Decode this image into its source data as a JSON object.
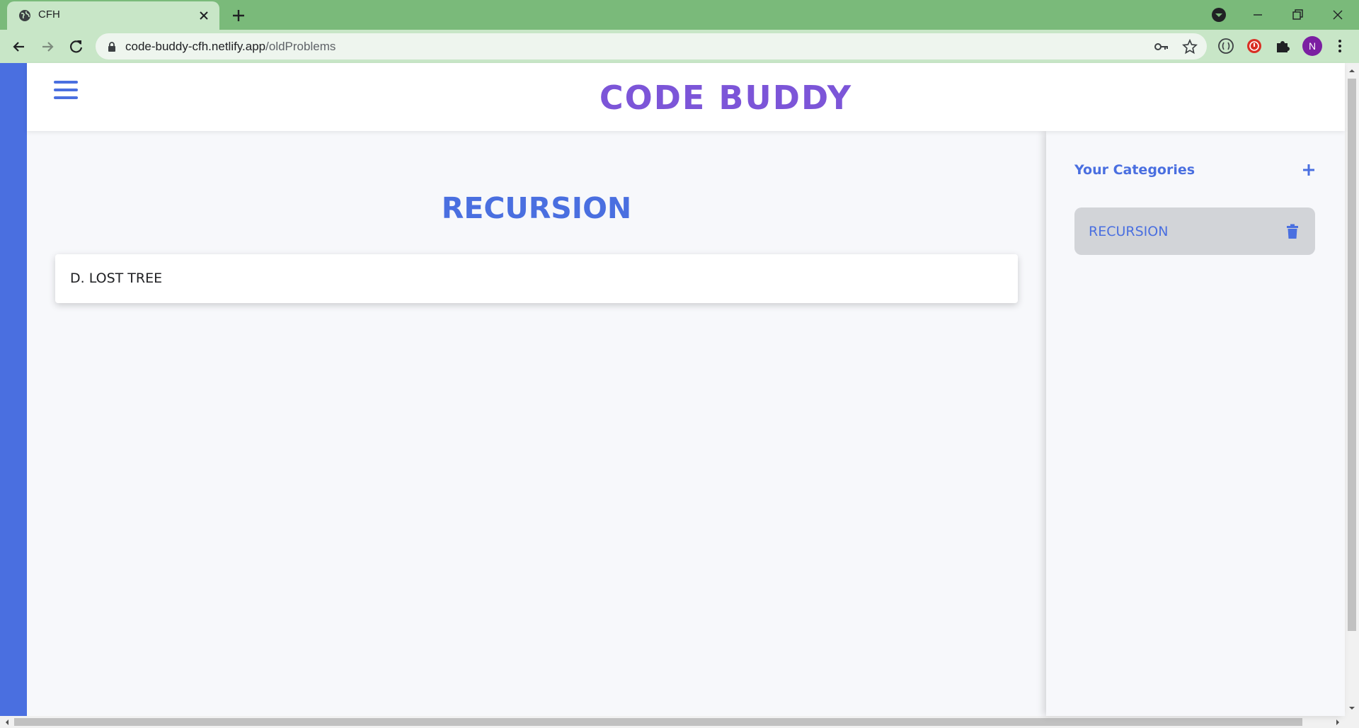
{
  "browser": {
    "tab_title": "CFH",
    "url_domain": "code-buddy-cfh.netlify.app",
    "url_path": "/oldProblems",
    "profile_initial": "N"
  },
  "header": {
    "brand": "CODE BUDDY"
  },
  "main": {
    "title": "RECURSION",
    "problems": [
      {
        "label": "D. LOST TREE"
      }
    ]
  },
  "sidebar": {
    "heading": "Your Categories",
    "categories": [
      {
        "label": "RECURSION"
      }
    ]
  },
  "colors": {
    "accent": "#4a6fe0",
    "brand": "#7c55d8",
    "chrome_bar": "#7aba7a",
    "chrome_tab": "#c8e6c7",
    "category_bg": "#d2d4d8"
  }
}
